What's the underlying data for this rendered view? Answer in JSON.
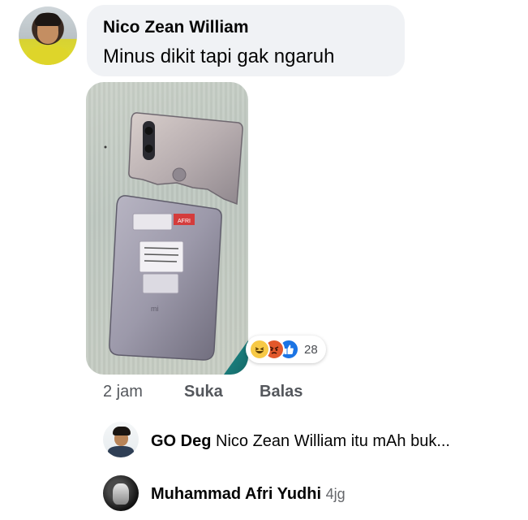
{
  "comment": {
    "author": "Nico Zean William",
    "text": "Minus dikit tapi gak ngaruh",
    "time": "2 jam",
    "like_label": "Suka",
    "reply_label": "Balas",
    "reaction_count": "28",
    "reactions": [
      "haha-reaction-icon",
      "angry-reaction-icon",
      "like-reaction-icon"
    ],
    "photo_label_text": "AFRI"
  },
  "replies": [
    {
      "author": "GO Deg",
      "text": "Nico Zean William itu mAh buk...",
      "time": ""
    },
    {
      "author": "Muhammad Afri Yudhi",
      "text": "",
      "time": "4jg"
    }
  ],
  "colors": {
    "bubble": "#f0f2f5",
    "like_blue": "#1b74e4",
    "angry_orange": "#e2582c",
    "haha_yellow": "#f7c945",
    "secondary_text": "#65676b"
  }
}
